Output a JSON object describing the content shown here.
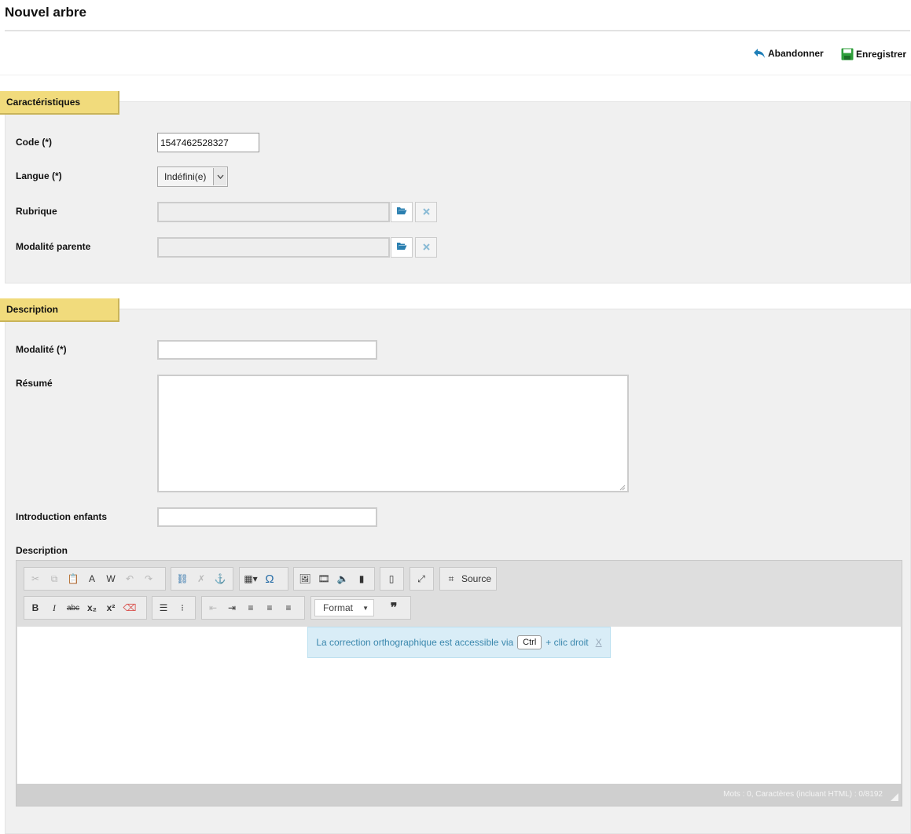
{
  "page": {
    "title": "Nouvel arbre"
  },
  "actions": {
    "cancel_label": "Abandonner",
    "save_label": "Enregistrer"
  },
  "sections": {
    "characteristics": {
      "title": "Caractéristiques",
      "code_label": "Code (*)",
      "code_value": "1547462528327",
      "language_label": "Langue (*)",
      "language_value": "Indéfini(e)",
      "rubric_label": "Rubrique",
      "parent_label": "Modalité parente"
    },
    "description": {
      "title": "Description",
      "modality_label": "Modalité (*)",
      "summary_label": "Résumé",
      "intro_label": "Introduction enfants",
      "description_label": "Description"
    }
  },
  "editor": {
    "source_label": "Source",
    "format_label": "Format",
    "spell_notice_prefix": "La correction orthographique est accessible via",
    "spell_notice_key": "Ctrl",
    "spell_notice_suffix": "+ clic droit",
    "spell_notice_close": "X",
    "word_count": "Mots : 0, Caractères (incluant HTML) : 0/8192"
  },
  "icons": {
    "cancel": "undo-arrow-icon",
    "save": "floppy-disk-icon",
    "browse": "folder-open-icon",
    "clear": "close-icon"
  },
  "colors": {
    "tab": "#f1db7c",
    "section_bg": "#f0f0f0",
    "notice_bg": "#d9edf7",
    "notice_text": "#3a87ad",
    "save_green": "#2e9e3a",
    "cancel_blue": "#1f7fb8"
  }
}
